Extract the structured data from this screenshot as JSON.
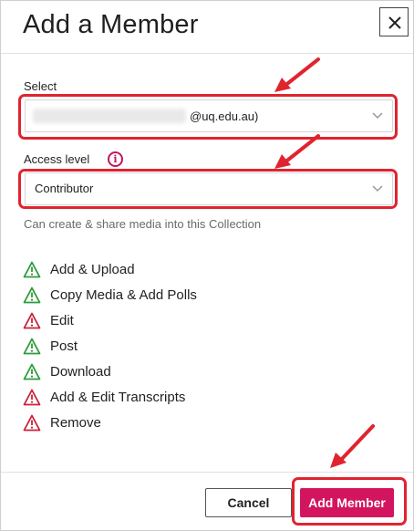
{
  "dialog": {
    "title": "Add a Member",
    "close_icon": "close-icon"
  },
  "select": {
    "label": "Select",
    "value_suffix": "@uq.edu.au)",
    "value_redacted": true
  },
  "access": {
    "label": "Access level",
    "info_icon": "info-icon",
    "value": "Contributor",
    "helper": "Can create & share media into this Collection"
  },
  "permissions": [
    {
      "label": "Add & Upload",
      "status": "allowed"
    },
    {
      "label": "Copy Media & Add Polls",
      "status": "allowed"
    },
    {
      "label": "Edit",
      "status": "denied"
    },
    {
      "label": "Post",
      "status": "allowed"
    },
    {
      "label": "Download",
      "status": "allowed"
    },
    {
      "label": "Add & Edit Transcripts",
      "status": "denied"
    },
    {
      "label": "Remove",
      "status": "denied"
    }
  ],
  "footer": {
    "cancel_label": "Cancel",
    "add_label": "Add Member"
  },
  "colors": {
    "allowed": "#2e9b3c",
    "denied": "#c9233a",
    "accent": "#d3155f",
    "annotation": "#e0242f"
  }
}
